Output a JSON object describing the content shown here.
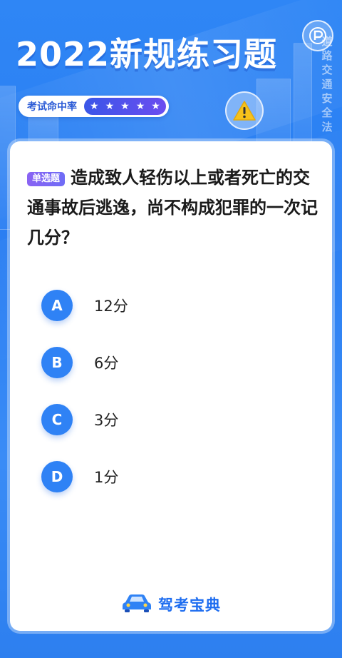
{
  "header": {
    "title": "2022新规练习题",
    "vertical_slogan": [
      "道",
      "路",
      "交",
      "通",
      "安",
      "全",
      "法"
    ]
  },
  "rate": {
    "label": "考试命中率",
    "stars": 5
  },
  "question": {
    "type_badge": "单选题",
    "text": "造成致人轻伤以上或者死亡的交通事故后逃逸，尚不构成犯罪的一次记几分？"
  },
  "options": [
    {
      "letter": "A",
      "text": "12分"
    },
    {
      "letter": "B",
      "text": "6分"
    },
    {
      "letter": "C",
      "text": "3分"
    },
    {
      "letter": "D",
      "text": "1分"
    }
  ],
  "footer": {
    "brand": "驾考宝典",
    "icon": "car-icon"
  },
  "colors": {
    "primary": "#2f82f5",
    "accent_purple": "#7a5ff2",
    "brand_blue": "#1e6df0",
    "warning_yellow": "#f7c21b"
  }
}
